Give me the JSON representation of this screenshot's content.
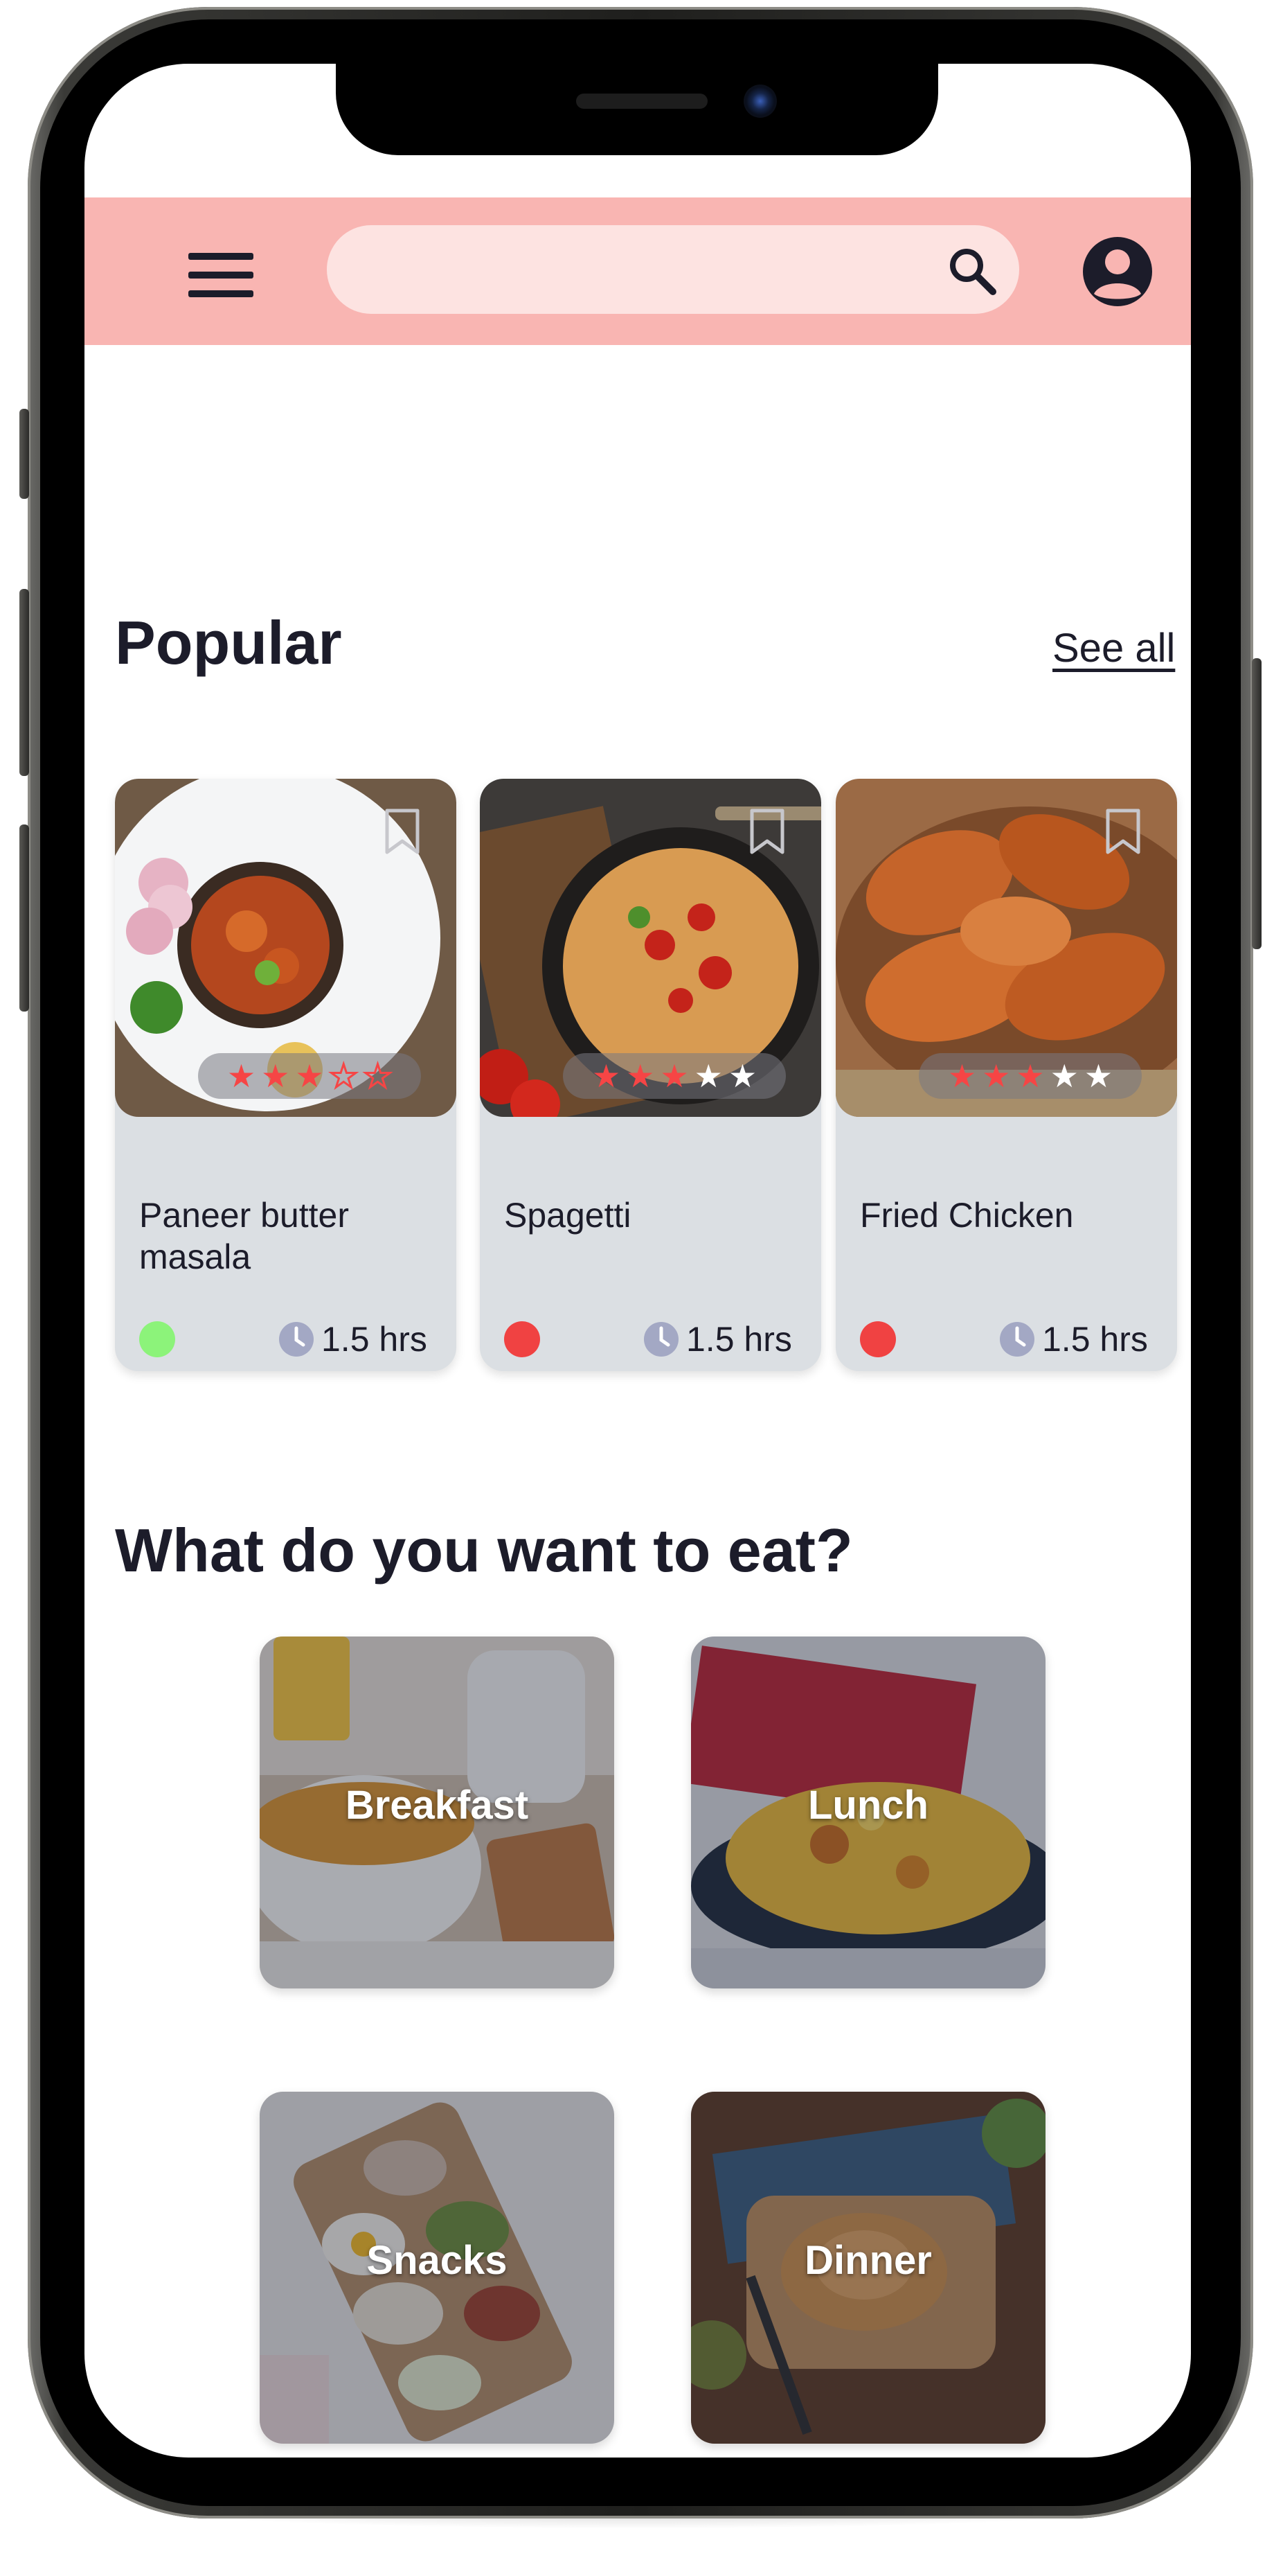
{
  "header": {
    "search_placeholder": "",
    "search_value": ""
  },
  "popular": {
    "title": "Popular",
    "see_all": "See all",
    "cards": [
      {
        "name": "Paneer butter masala",
        "time": "1.5 hrs",
        "rating": 3,
        "diet": "veg",
        "diet_color": "#8cf37a"
      },
      {
        "name": "Spagetti",
        "time": "1.5 hrs",
        "rating": 3,
        "diet": "non-veg",
        "diet_color": "#f04242"
      },
      {
        "name": "Fried Chicken",
        "time": "1.5 hrs",
        "rating": 3,
        "diet": "non-veg",
        "diet_color": "#f04242"
      }
    ]
  },
  "categories": {
    "title": "What do you want to eat?",
    "items": [
      {
        "label": "Breakfast"
      },
      {
        "label": "Lunch"
      },
      {
        "label": "Snacks"
      },
      {
        "label": "Dinner"
      }
    ]
  },
  "colors": {
    "header_bg": "#f9b5b2",
    "search_bg": "#fde3e1",
    "card_bg": "#dbdfe3",
    "star": "#f64545",
    "text": "#1c1c2a"
  }
}
